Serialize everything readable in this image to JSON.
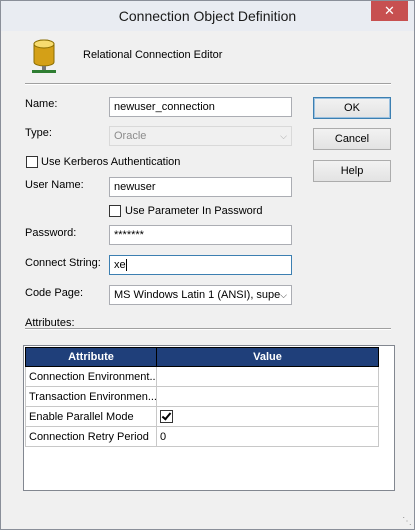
{
  "window": {
    "title": "Connection Object Definition",
    "close_symbol": "✕"
  },
  "header": {
    "text": "Relational Connection Editor",
    "icon": "database-icon"
  },
  "form": {
    "name_label": "Name:",
    "name_value": "newuser_connection",
    "type_label": "Type:",
    "type_value": "Oracle",
    "kerberos_label": "Use Kerberos Authentication",
    "kerberos_checked": false,
    "username_label": "User Name:",
    "username_value": "newuser",
    "param_password_label": "Use Parameter In Password",
    "param_password_checked": false,
    "password_label": "Password:",
    "password_value": "*******",
    "connect_string_label": "Connect String:",
    "connect_string_value": "xe",
    "code_page_label": "Code Page:",
    "code_page_value": "MS Windows Latin 1 (ANSI), supe",
    "attributes_label": "Attributes:"
  },
  "buttons": {
    "ok": "OK",
    "cancel": "Cancel",
    "help": "Help"
  },
  "attributes_table": {
    "columns": [
      "Attribute",
      "Value"
    ],
    "rows": [
      {
        "attribute": "Connection Environment...",
        "value": ""
      },
      {
        "attribute": "Transaction Environmen...",
        "value": ""
      },
      {
        "attribute": "Enable Parallel Mode",
        "value": "checked"
      },
      {
        "attribute": "Connection Retry Period",
        "value": "0"
      }
    ]
  },
  "colors": {
    "table_header": "#1f3f7a",
    "close_button": "#c75050"
  }
}
